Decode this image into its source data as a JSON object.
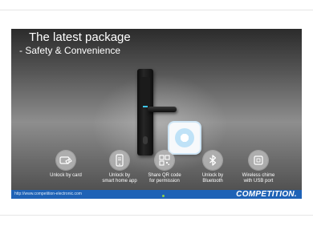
{
  "slide": {
    "headline": "The latest package",
    "subline": "- Safety & Convenience"
  },
  "features": [
    {
      "label": "Unlock by card",
      "icon": "card-icon"
    },
    {
      "label": "Unlock by\nsmart home app",
      "icon": "smartphone-icon"
    },
    {
      "label": "Share QR code\nfor permission",
      "icon": "qr-code-icon"
    },
    {
      "label": "Unlock by\nBluetooth",
      "icon": "bluetooth-icon"
    },
    {
      "label": "Wireless chime\nwith USB port",
      "icon": "chime-icon"
    }
  ],
  "footer": {
    "url": "http://www.competition-electronic.com",
    "brand": "COMPETITION."
  },
  "colors": {
    "footer_bar": "#1e62b6",
    "text": "#ffffff",
    "lock_led": "#3fc7f0"
  }
}
